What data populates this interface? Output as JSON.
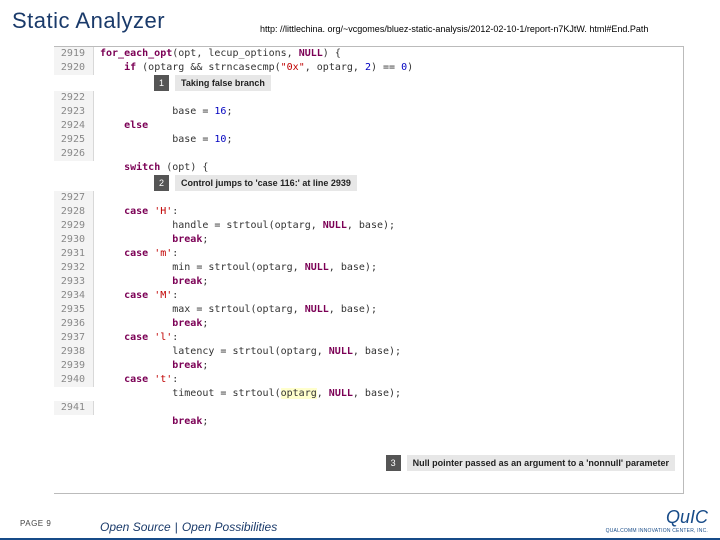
{
  "title": "Static Analyzer",
  "url": "http: //littlechina. org/~vcgomes/bluez-static-analysis/2012-02-10-1/report-n7KJtW. html#End.Path",
  "footer": {
    "page_label": "PAGE 9",
    "tagline_left": "Open Source",
    "tagline_sep": "|",
    "tagline_right": "Open Possibilities"
  },
  "logo": {
    "name": "QuIC",
    "sub": "QUALCOMM INNOVATION CENTER, INC."
  },
  "annotations": {
    "a1": {
      "num": "1",
      "text": "Taking false branch"
    },
    "a2": {
      "num": "2",
      "text": "Control jumps to 'case 116:' at line 2939"
    },
    "a3": {
      "num": "3",
      "text": "Null pointer passed as an argument to a 'nonnull' parameter"
    }
  },
  "lines": [
    {
      "n": "2919",
      "html": "<span class=\"kw\">for_each_opt</span>(opt, lecup_options, <span class=\"kw\">NULL</span>) {"
    },
    {
      "n": "2920",
      "html": "    <span class=\"kw\">if</span> (optarg &amp;&amp; strncasecmp(<span class=\"str\">\"0x\"</span>, optarg, <span class=\"num\">2</span>) == <span class=\"num\">0</span>)"
    },
    {
      "annot": "a1"
    },
    {
      "n": "2922",
      "html": ""
    },
    {
      "n": "2923",
      "html": "            base = <span class=\"num\">16</span>;"
    },
    {
      "n": "2924",
      "html": "    <span class=\"kw\">else</span>"
    },
    {
      "n": "2925",
      "html": "            base = <span class=\"num\">10</span>;"
    },
    {
      "n": "2926",
      "html": ""
    },
    {
      "n": "",
      "html": "    <span class=\"kw\">switch</span> (opt) {"
    },
    {
      "annot": "a2"
    },
    {
      "n": "2927",
      "html": ""
    },
    {
      "n": "2928",
      "html": "    <span class=\"kw\">case</span> <span class=\"str\">'H'</span>:"
    },
    {
      "n": "2929",
      "html": "            handle = strtoul(optarg, <span class=\"kw\">NULL</span>, base);"
    },
    {
      "n": "2930",
      "html": "            <span class=\"kw\">break</span>;"
    },
    {
      "n": "2931",
      "html": "    <span class=\"kw\">case</span> <span class=\"str\">'m'</span>:"
    },
    {
      "n": "2932",
      "html": "            min = strtoul(optarg, <span class=\"kw\">NULL</span>, base);"
    },
    {
      "n": "2933",
      "html": "            <span class=\"kw\">break</span>;"
    },
    {
      "n": "2934",
      "html": "    <span class=\"kw\">case</span> <span class=\"str\">'M'</span>:"
    },
    {
      "n": "2935",
      "html": "            max = strtoul(optarg, <span class=\"kw\">NULL</span>, base);"
    },
    {
      "n": "2936",
      "html": "            <span class=\"kw\">break</span>;"
    },
    {
      "n": "2937",
      "html": "    <span class=\"kw\">case</span> <span class=\"str\">'l'</span>:"
    },
    {
      "n": "2938",
      "html": "            latency = strtoul(optarg, <span class=\"kw\">NULL</span>, base);"
    },
    {
      "n": "2939",
      "html": "            <span class=\"kw\">break</span>;"
    },
    {
      "n": "2940",
      "html": "    <span class=\"kw\">case</span> <span class=\"str\">'t'</span>:"
    },
    {
      "n": "",
      "html": "            timeout = strtoul(<span class=\"hln\">optarg</span>, <span class=\"kw\">NULL</span>, base);"
    },
    {
      "annot": "a3",
      "float": true
    },
    {
      "n": "2941",
      "html": ""
    },
    {
      "n": "",
      "html": "            <span class=\"kw\">break</span>;"
    }
  ]
}
